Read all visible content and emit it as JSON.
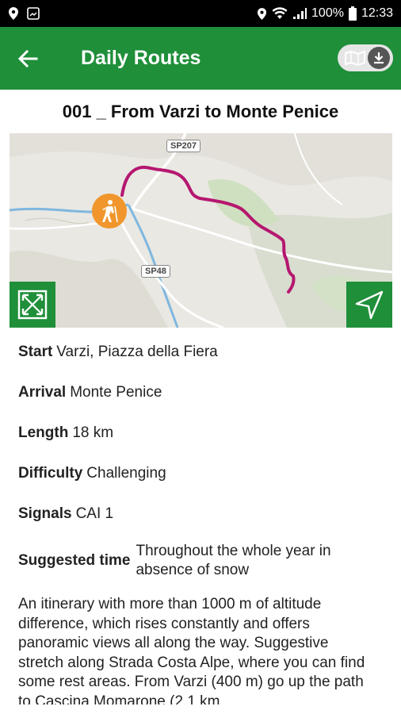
{
  "status_bar": {
    "battery_text": "100%",
    "time": "12:33",
    "icons": [
      "location-icon",
      "image-disabled-icon",
      "location-icon",
      "wifi-icon",
      "signal-icon",
      "battery-icon"
    ]
  },
  "app_bar": {
    "title": "Daily Routes",
    "back_icon": "arrow-left-icon",
    "offline_map_icons": [
      "map-icon",
      "download-icon"
    ],
    "color": "#1f8f3a"
  },
  "route": {
    "title": "001 _ From Varzi to Monte Penice"
  },
  "map": {
    "road_labels": [
      "SP207",
      "SP48"
    ],
    "start_marker": "hiker-icon",
    "route_color": "#b5176f",
    "controls": [
      "expand-icon",
      "navigate-icon"
    ]
  },
  "details": {
    "start": {
      "label": "Start",
      "value": "Varzi, Piazza della Fiera"
    },
    "arrival": {
      "label": "Arrival",
      "value": "Monte Penice"
    },
    "length": {
      "label": "Length",
      "value": "18 km"
    },
    "difficulty": {
      "label": "Difficulty",
      "value": "Challenging"
    },
    "signals": {
      "label": "Signals",
      "value": "CAI 1"
    },
    "suggested_time": {
      "label": "Suggested time",
      "value": "Throughout the whole year in absence of snow"
    }
  },
  "description": "An itinerary with more than 1000 m of altitude difference, which rises constantly and offers panoramic views all along the way. Suggestive stretch along Strada Costa Alpe, where you can find some rest areas. From Varzi (400 m) go up the path to Cascina Momarone (2.1 km"
}
